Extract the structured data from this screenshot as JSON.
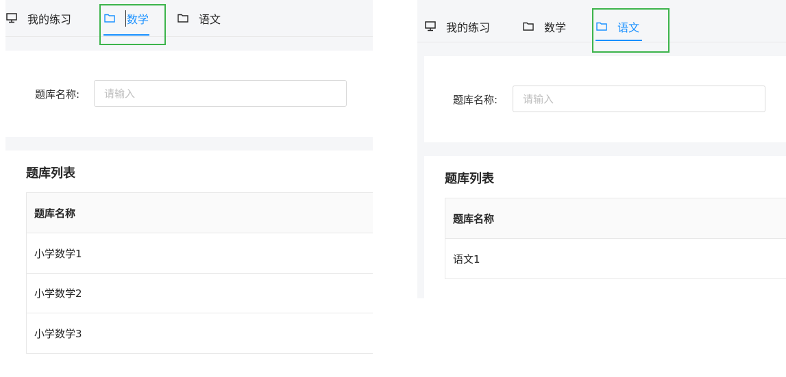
{
  "screens": [
    {
      "tabs": [
        {
          "label": "我的练习",
          "icon": "monitor-icon",
          "active": false
        },
        {
          "label": "数学",
          "icon": "folder-icon",
          "active": true
        },
        {
          "label": "语文",
          "icon": "folder-icon",
          "active": false
        }
      ],
      "search": {
        "label": "题库名称:",
        "placeholder": "请输入",
        "value": ""
      },
      "list": {
        "title": "题库列表",
        "column": "题库名称",
        "rows": [
          "小学数学1",
          "小学数学2",
          "小学数学3"
        ]
      }
    },
    {
      "tabs": [
        {
          "label": "我的练习",
          "icon": "monitor-icon",
          "active": false
        },
        {
          "label": "数学",
          "icon": "folder-icon",
          "active": false
        },
        {
          "label": "语文",
          "icon": "folder-icon",
          "active": true
        }
      ],
      "search": {
        "label": "题库名称:",
        "placeholder": "请输入",
        "value": ""
      },
      "list": {
        "title": "题库列表",
        "column": "题库名称",
        "rows": [
          "语文1"
        ]
      }
    }
  ],
  "colors": {
    "accent": "#1890ff",
    "highlight": "#3cb44b",
    "background": "#f5f6f8"
  }
}
